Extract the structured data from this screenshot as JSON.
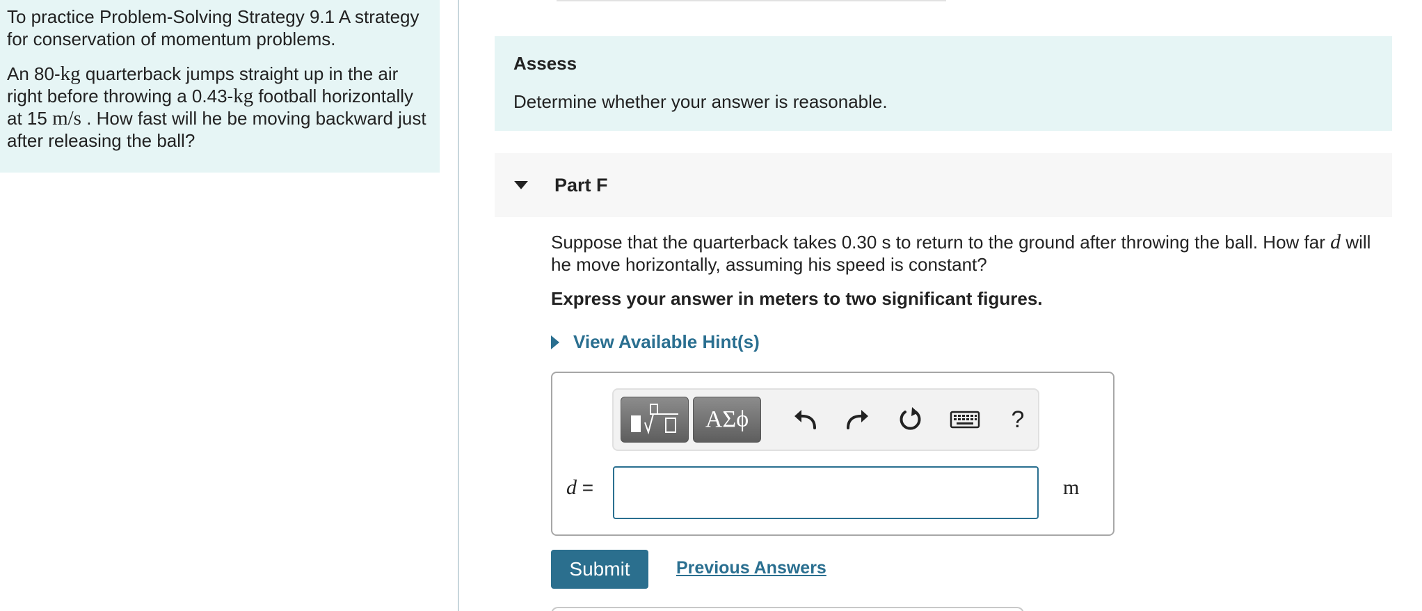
{
  "intro": {
    "strategy_text": "To practice Problem-Solving Strategy 9.1 A strategy for conservation of momentum problems.",
    "problem": {
      "t1": "An 80-",
      "u1": "kg",
      "t2": " quarterback jumps straight up in the air right before throwing a 0.43-",
      "u2": "kg",
      "t3": " football horizontally at 15 ",
      "u3": "m/s",
      "t4": " . How fast will he be moving backward just after releasing the ball?"
    }
  },
  "assess": {
    "title": "Assess",
    "text": "Determine whether your answer is reasonable."
  },
  "part": {
    "label": "Part F",
    "question_a": "Suppose that the quarterback takes 0.30 s to return to the ground after throwing the ball. How far ",
    "question_var": "d",
    "question_b": " will he move horizontally, assuming his speed is constant?",
    "instruction": "Express your answer in meters to two significant figures.",
    "hint_label": "View Available Hint(s)"
  },
  "answer": {
    "variable": "d",
    "equals": " =",
    "value": "",
    "unit": "m"
  },
  "toolbar": {
    "greek_label": "ΑΣϕ",
    "help_label": "?",
    "icons": [
      "template-icon",
      "undo-icon",
      "redo-icon",
      "reset-icon",
      "keyboard-icon",
      "help-icon"
    ]
  },
  "actions": {
    "submit_label": "Submit",
    "previous_answers_label": "Previous Answers"
  },
  "colors": {
    "panel_bg": "#e6f5f5",
    "accent": "#2a6f90",
    "submit_bg": "#2b6f8e"
  }
}
